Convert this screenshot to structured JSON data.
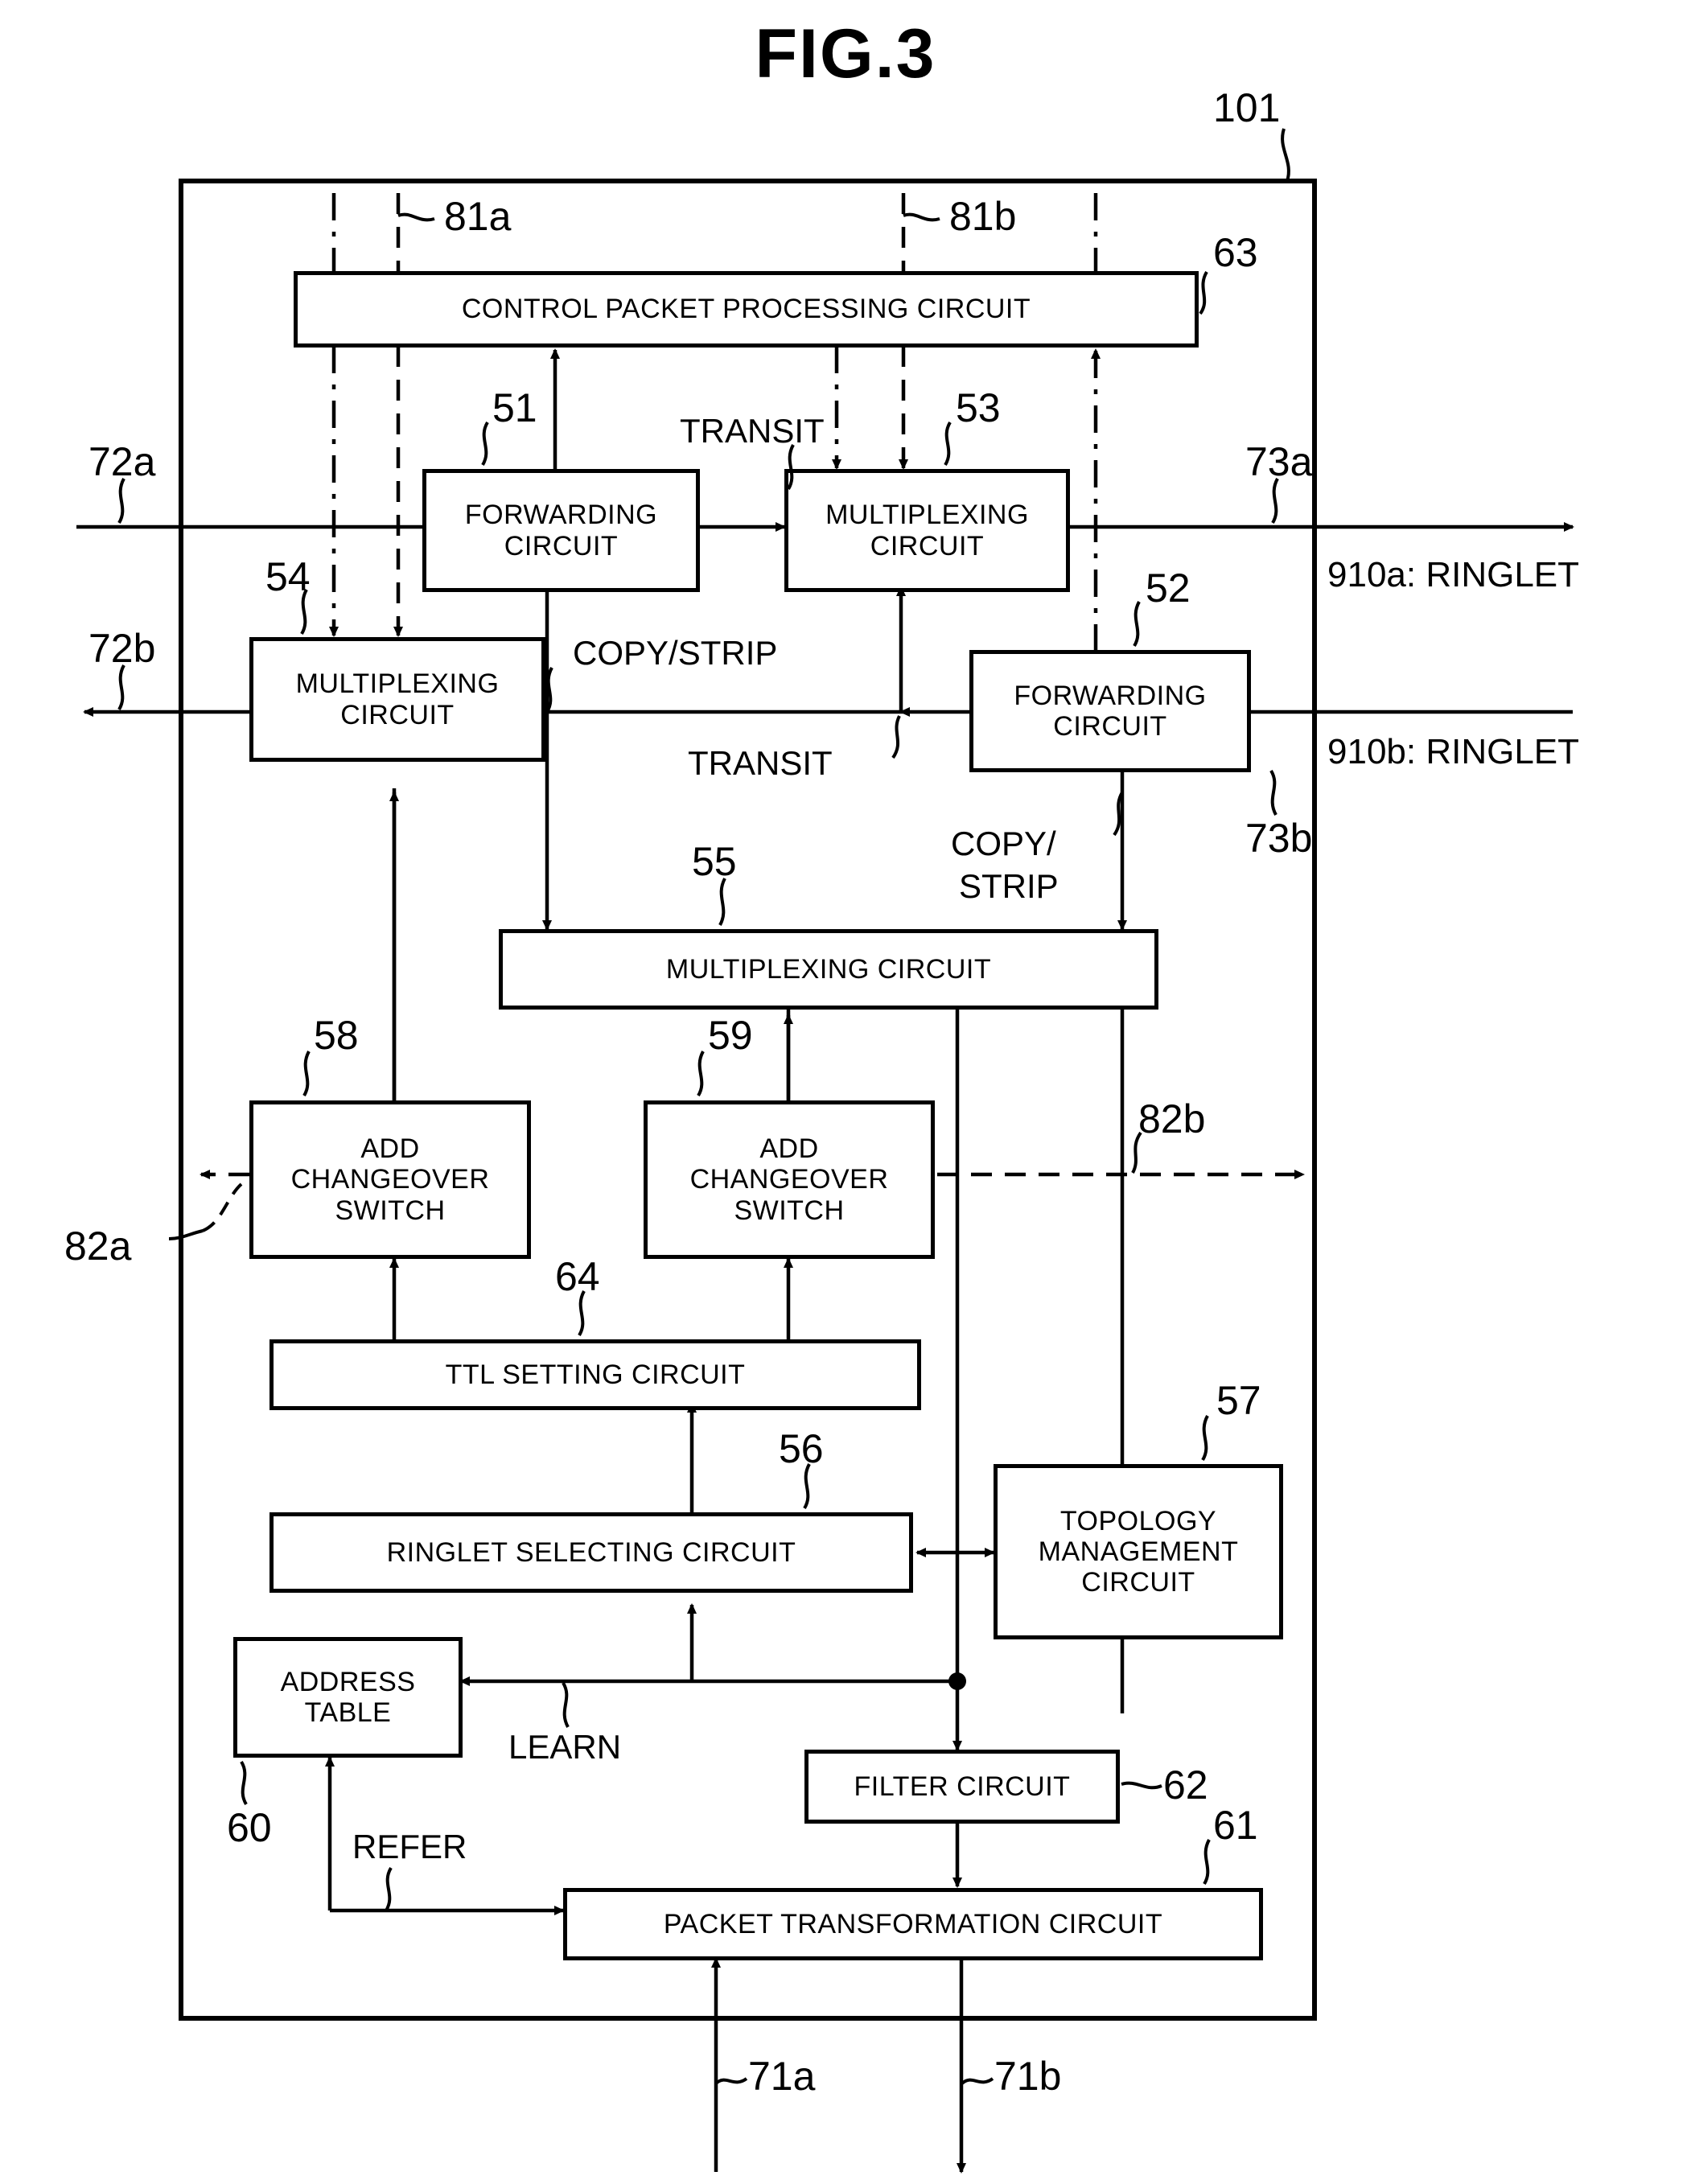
{
  "figure": {
    "title": "FIG.3",
    "device_ref": "101"
  },
  "blocks": [
    {
      "id": "control-packet-processing-circuit",
      "ref": "63",
      "label": "CONTROL PACKET PROCESSING CIRCUIT"
    },
    {
      "id": "forwarding-circuit-51",
      "ref": "51",
      "label": "FORWARDING\nCIRCUIT",
      "line1": "FORWARDING",
      "line2": "CIRCUIT"
    },
    {
      "id": "multiplexing-circuit-53",
      "ref": "53",
      "line1": "MULTIPLEXING",
      "line2": "CIRCUIT"
    },
    {
      "id": "multiplexing-circuit-54",
      "ref": "54",
      "line1": "MULTIPLEXING",
      "line2": "CIRCUIT"
    },
    {
      "id": "forwarding-circuit-52",
      "ref": "52",
      "line1": "FORWARDING",
      "line2": "CIRCUIT"
    },
    {
      "id": "multiplexing-circuit-55",
      "ref": "55",
      "label": "MULTIPLEXING CIRCUIT"
    },
    {
      "id": "add-changeover-switch-58",
      "ref": "58",
      "line1": "ADD",
      "line2": "CHANGEOVER",
      "line3": "SWITCH"
    },
    {
      "id": "add-changeover-switch-59",
      "ref": "59",
      "line1": "ADD",
      "line2": "CHANGEOVER",
      "line3": "SWITCH"
    },
    {
      "id": "ttl-setting-circuit",
      "ref": "64",
      "label": "TTL SETTING CIRCUIT"
    },
    {
      "id": "ringlet-selecting-circuit",
      "ref": "56",
      "label": "RINGLET SELECTING CIRCUIT"
    },
    {
      "id": "topology-management-circuit",
      "ref": "57",
      "line1": "TOPOLOGY",
      "line2": "MANAGEMENT",
      "line3": "CIRCUIT"
    },
    {
      "id": "address-table",
      "ref": "60",
      "line1": "ADDRESS",
      "line2": "TABLE"
    },
    {
      "id": "filter-circuit",
      "ref": "62",
      "label": "FILTER CIRCUIT"
    },
    {
      "id": "packet-transformation-circuit",
      "ref": "61",
      "label": "PACKET TRANSFORMATION CIRCUIT"
    }
  ],
  "block_text": {
    "control_packet_processing_circuit": "CONTROL PACKET PROCESSING CIRCUIT",
    "forwarding_1": "FORWARDING",
    "forwarding_2": "CIRCUIT",
    "multiplexing_1": "MULTIPLEXING",
    "multiplexing_2": "CIRCUIT",
    "multiplexing_circuit_55": "MULTIPLEXING CIRCUIT",
    "add_1": "ADD",
    "add_2": "CHANGEOVER",
    "add_3": "SWITCH",
    "ttl_setting_circuit": "TTL SETTING CIRCUIT",
    "ringlet_selecting_circuit": "RINGLET SELECTING CIRCUIT",
    "topology_1": "TOPOLOGY",
    "topology_2": "MANAGEMENT",
    "topology_3": "CIRCUIT",
    "address_1": "ADDRESS",
    "address_2": "TABLE",
    "filter_circuit": "FILTER CIRCUIT",
    "packet_transformation_circuit": "PACKET TRANSFORMATION CIRCUIT"
  },
  "refs": {
    "r101": "101",
    "r63": "63",
    "r51": "51",
    "r53": "53",
    "r54": "54",
    "r52": "52",
    "r55": "55",
    "r56": "56",
    "r57": "57",
    "r58": "58",
    "r59": "59",
    "r60": "60",
    "r61": "61",
    "r62": "62",
    "r64": "64",
    "r81a": "81a",
    "r81b": "81b",
    "r82a": "82a",
    "r82b": "82b",
    "r71a": "71a",
    "r71b": "71b",
    "r72a": "72a",
    "r72b": "72b",
    "r73a": "73a",
    "r73b": "73b"
  },
  "signal_labels": {
    "transit_top": "TRANSIT",
    "transit_bottom": "TRANSIT",
    "copy_strip_left": "COPY/STRIP",
    "copy_strip_right_1": "COPY/",
    "copy_strip_right_2": "STRIP",
    "learn": "LEARN",
    "refer": "REFER"
  },
  "ringlets": {
    "ringlet_a": "910a: RINGLET",
    "ringlet_b": "910b: RINGLET"
  }
}
